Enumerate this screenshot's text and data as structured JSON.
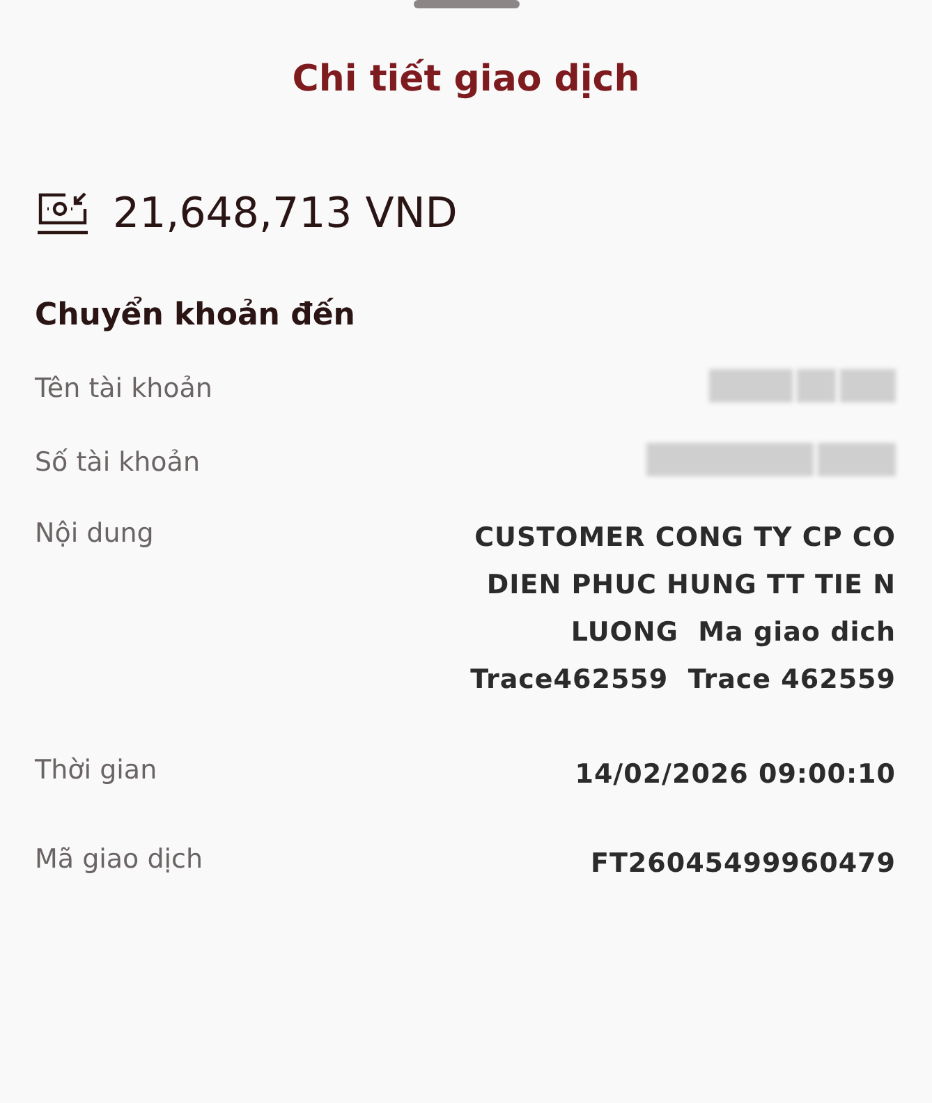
{
  "sheet": {
    "title": "Chi tiết giao dịch"
  },
  "amount": "21,648,713 VND",
  "section": "Chuyển khoản đến",
  "rows": [
    {
      "label": "Tên tài khoản",
      "kind": "redacted"
    },
    {
      "label": "Số tài khoản",
      "kind": "redacted"
    },
    {
      "label": "Nội dung",
      "kind": "text",
      "value": "CUSTOMER CONG TY CP CO DIEN PHUC HUNG TT TIE N LUONG  Ma giao dich  Trace462559  Trace 462559"
    },
    {
      "label": "Thời gian",
      "kind": "text",
      "value": "14/02/2026 09:00:10"
    },
    {
      "label": "Mã giao dịch",
      "kind": "text",
      "value": "FT26045499960479"
    }
  ]
}
